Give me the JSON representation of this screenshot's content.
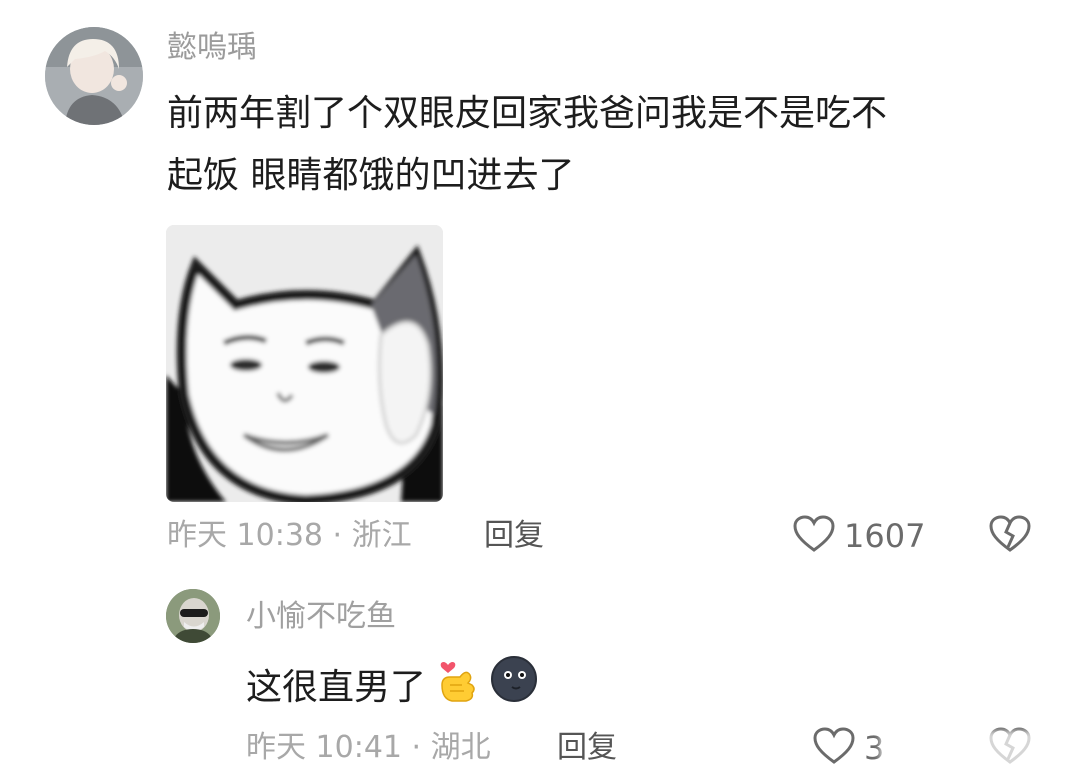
{
  "main_comment": {
    "username": "懿嗚瑀",
    "text_lines": [
      "前两年割了个双眼皮回家我爸问我是不是吃不",
      "起饭 眼睛都饿的凹进去了"
    ],
    "meta": "昨天 10:38 · 浙江",
    "reply_label": "回复",
    "like_count": "1607"
  },
  "sub_reply": {
    "username": "小愉不吃鱼",
    "text": "这很直男了",
    "emojis": [
      "finger-heart-emoji",
      "new-moon-face-emoji"
    ],
    "meta": "昨天 10:41 · 湖北",
    "reply_label": "回复",
    "like_count": "3"
  },
  "colors": {
    "text_primary": "#1d1d1d",
    "text_secondary": "#a8a8a8",
    "icon_gray": "#6b6b6b"
  }
}
